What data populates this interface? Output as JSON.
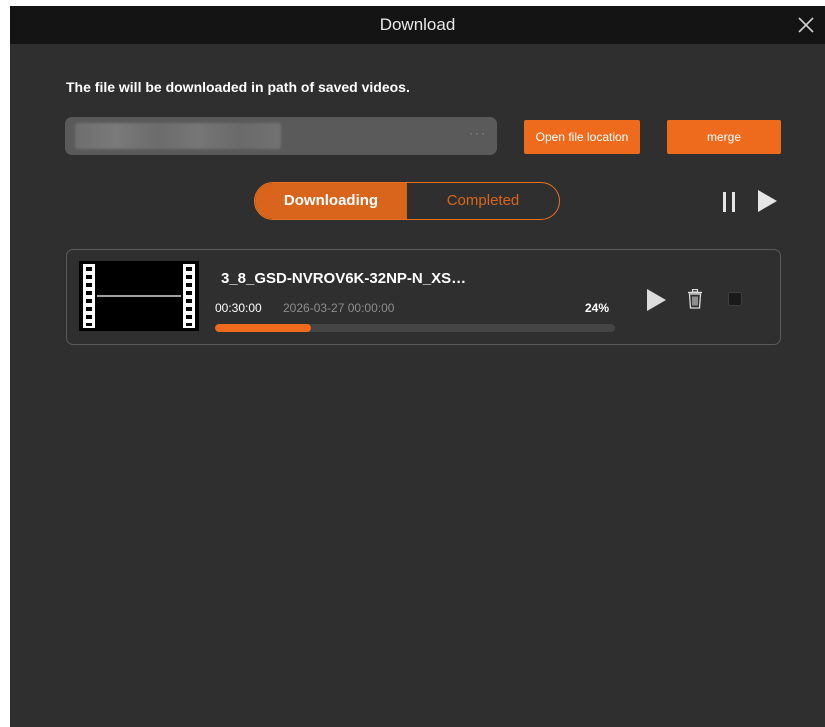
{
  "window": {
    "title": "Download"
  },
  "path_section": {
    "label": "The file will be downloaded in path of saved videos.",
    "browse_dots": "···",
    "open_location_label": "Open file location",
    "merge_label": "merge"
  },
  "tabs": [
    {
      "label": "Downloading",
      "active": true
    },
    {
      "label": "Completed",
      "active": false
    }
  ],
  "controls": {
    "pause_all_icon": "pause-icon",
    "start_all_icon": "play-icon"
  },
  "downloads": [
    {
      "name": "3_8_GSD-NVROV6K-32NP-N_XS…",
      "duration": "00:30:00",
      "date": "2026-03-27 00:00:00",
      "percent_label": "24%",
      "progress": 0.24,
      "icons": [
        "video-thumbnail-icon",
        "play-icon",
        "trash-icon",
        "checkbox"
      ]
    }
  ],
  "colors": {
    "accent": "#ee6b1e",
    "background": "#2f2f2f",
    "titlebar": "#141414"
  }
}
